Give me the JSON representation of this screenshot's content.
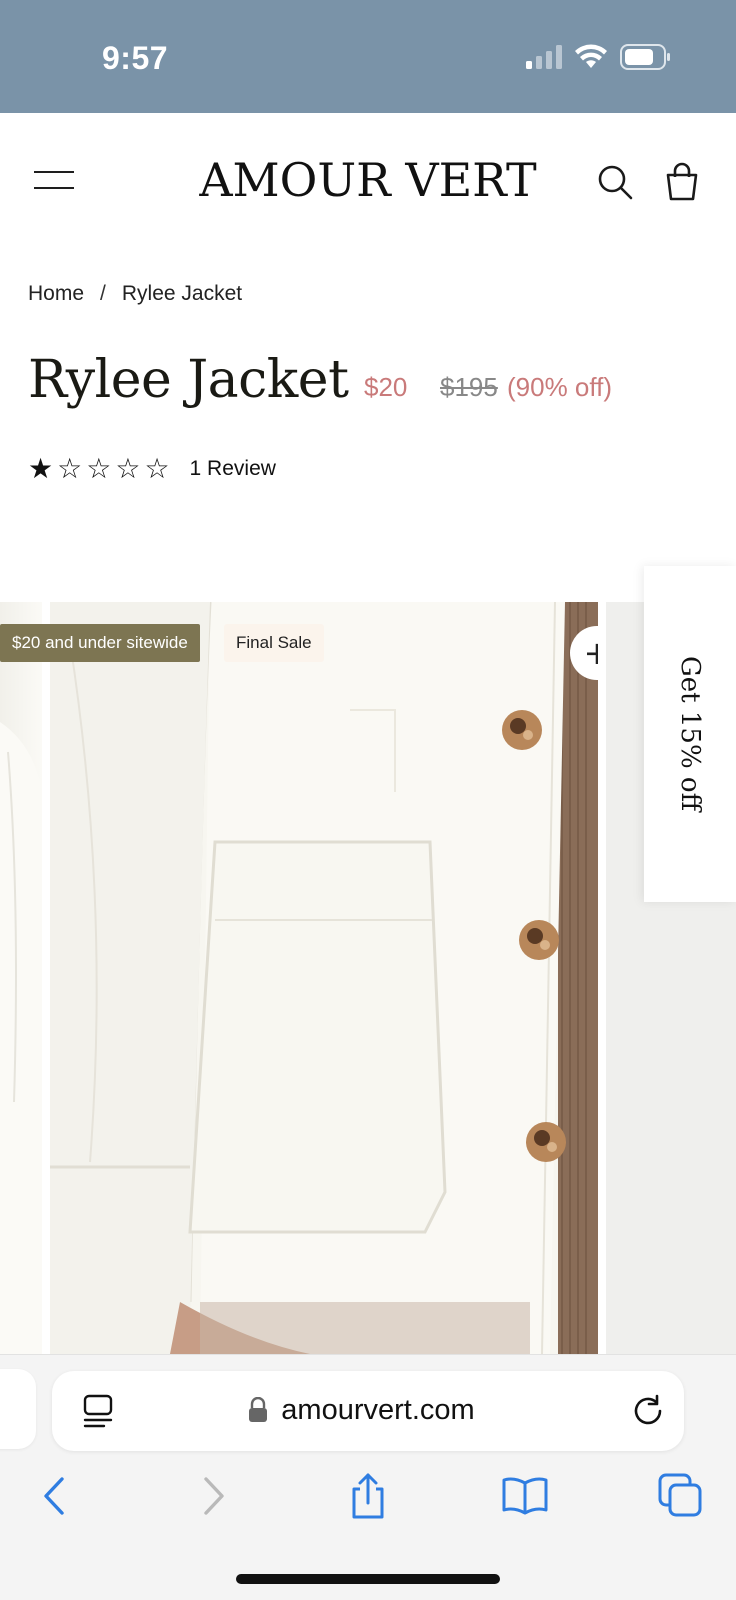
{
  "status_bar": {
    "time": "9:57",
    "color": "#7a93a8"
  },
  "header": {
    "brand": "AMOUR VERT",
    "icons": [
      "menu-icon",
      "search-icon",
      "shopping-bag-icon"
    ]
  },
  "breadcrumb": {
    "home": "Home",
    "separator": "/",
    "current": "Rylee Jacket"
  },
  "product": {
    "title": "Rylee Jacket",
    "price_now": "$20",
    "price_was": "$195",
    "discount": "(90% off)",
    "rating": 1,
    "rating_max": 5,
    "review_label": "1 Review",
    "sale_color": "#c97a7a"
  },
  "gallery": {
    "badge_under": "$20 and under sitewide",
    "badge_final": "Final Sale",
    "zoom_label": "+"
  },
  "promo_tab": {
    "label": "Get 15% off"
  },
  "browser": {
    "url": "amourvert.com",
    "accent": "#2f7de1",
    "nav_icons": [
      "back-icon",
      "forward-icon",
      "share-icon",
      "bookmarks-icon",
      "tabs-icon"
    ]
  }
}
